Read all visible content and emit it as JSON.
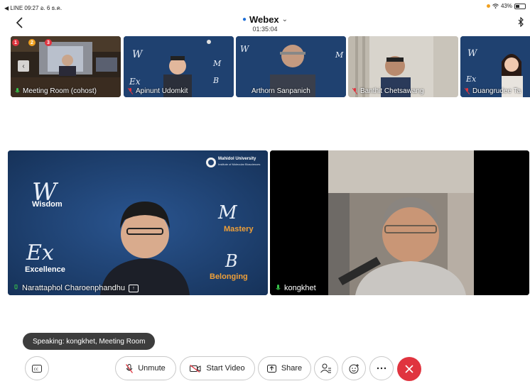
{
  "status": {
    "left": "◀ LINE  09:27  อ. 6 ธ.ค.",
    "battery": "43%",
    "battery_level": 0.43
  },
  "header": {
    "app_title": "Webex",
    "timer": "01:35:04"
  },
  "participants": [
    {
      "name": "Meeting Room (cohost)",
      "mic": "on"
    },
    {
      "name": "Apinunt Udomkit",
      "mic": "muted"
    },
    {
      "name": "Arthorn Sanpanich",
      "mic": "on"
    },
    {
      "name": "Banthit Chetsawang",
      "mic": "muted"
    },
    {
      "name": "Duangrudee Ta",
      "mic": "muted"
    }
  ],
  "thumb_badges": [
    "1",
    "2",
    "3"
  ],
  "main_videos": [
    {
      "name": "Narattaphol Charoenphandhu",
      "sharing": true
    },
    {
      "name": "kongkhet",
      "mic": "on"
    }
  ],
  "backdrop": {
    "university": "Mahidol University",
    "faculty": "Institute of Molecular Biosciences",
    "wisdom": "Wisdom",
    "mastery": "Mastery",
    "excellence": "Excellence",
    "belonging": "Belonging"
  },
  "speaking": "Speaking: kongkhet, Meeting Room",
  "controls": {
    "unmute": "Unmute",
    "start_video": "Start Video",
    "share": "Share"
  },
  "colors": {
    "end_call": "#e0343f",
    "accent": "#1f6fd6",
    "muted": "#e0343f",
    "active_mic": "#37c24a"
  }
}
